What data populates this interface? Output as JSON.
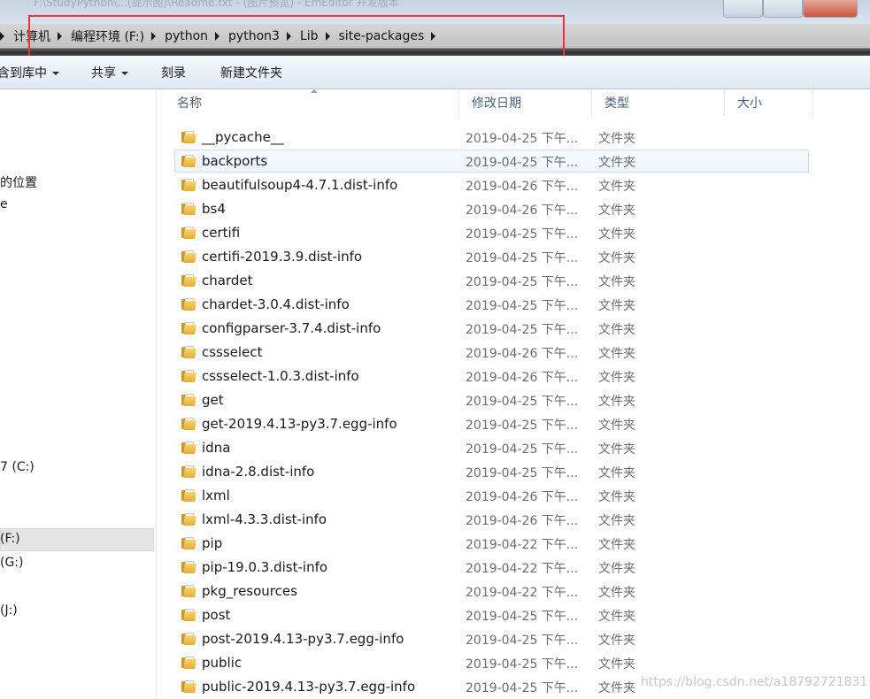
{
  "title_ghost": "F:\\StudyPython\\...(提示图)\\Readme.txt - (图片预览) - EmEditor 开发版本",
  "breadcrumb": [
    "计算机",
    "编程环境 (F:)",
    "python",
    "python3",
    "Lib",
    "site-packages"
  ],
  "toolbar": {
    "include_library": "含到库中",
    "share": "共享",
    "burn": "刻录",
    "new_folder": "新建文件夹"
  },
  "nav": {
    "recent_places": "的位置",
    "item_e": "e",
    "drive_c": "7 (C:)",
    "drive_f": "(F:)",
    "drive_g": "(G:)",
    "drive_j": "(J:)"
  },
  "columns": {
    "name": "名称",
    "modified": "修改日期",
    "type": "类型",
    "size": "大小"
  },
  "files": [
    {
      "name": "__pycache__",
      "date": "2019-04-25 下午...",
      "type": "文件夹"
    },
    {
      "name": "backports",
      "date": "2019-04-25 下午...",
      "type": "文件夹"
    },
    {
      "name": "beautifulsoup4-4.7.1.dist-info",
      "date": "2019-04-26 下午...",
      "type": "文件夹"
    },
    {
      "name": "bs4",
      "date": "2019-04-26 下午...",
      "type": "文件夹"
    },
    {
      "name": "certifi",
      "date": "2019-04-25 下午...",
      "type": "文件夹"
    },
    {
      "name": "certifi-2019.3.9.dist-info",
      "date": "2019-04-25 下午...",
      "type": "文件夹"
    },
    {
      "name": "chardet",
      "date": "2019-04-25 下午...",
      "type": "文件夹"
    },
    {
      "name": "chardet-3.0.4.dist-info",
      "date": "2019-04-25 下午...",
      "type": "文件夹"
    },
    {
      "name": "configparser-3.7.4.dist-info",
      "date": "2019-04-25 下午...",
      "type": "文件夹"
    },
    {
      "name": "cssselect",
      "date": "2019-04-26 下午...",
      "type": "文件夹"
    },
    {
      "name": "cssselect-1.0.3.dist-info",
      "date": "2019-04-26 下午...",
      "type": "文件夹"
    },
    {
      "name": "get",
      "date": "2019-04-25 下午...",
      "type": "文件夹"
    },
    {
      "name": "get-2019.4.13-py3.7.egg-info",
      "date": "2019-04-25 下午...",
      "type": "文件夹"
    },
    {
      "name": "idna",
      "date": "2019-04-25 下午...",
      "type": "文件夹"
    },
    {
      "name": "idna-2.8.dist-info",
      "date": "2019-04-25 下午...",
      "type": "文件夹"
    },
    {
      "name": "lxml",
      "date": "2019-04-26 下午...",
      "type": "文件夹"
    },
    {
      "name": "lxml-4.3.3.dist-info",
      "date": "2019-04-26 下午...",
      "type": "文件夹"
    },
    {
      "name": "pip",
      "date": "2019-04-22 下午...",
      "type": "文件夹"
    },
    {
      "name": "pip-19.0.3.dist-info",
      "date": "2019-04-22 下午...",
      "type": "文件夹"
    },
    {
      "name": "pkg_resources",
      "date": "2019-04-22 下午...",
      "type": "文件夹"
    },
    {
      "name": "post",
      "date": "2019-04-25 下午...",
      "type": "文件夹"
    },
    {
      "name": "post-2019.4.13-py3.7.egg-info",
      "date": "2019-04-25 下午...",
      "type": "文件夹"
    },
    {
      "name": "public",
      "date": "2019-04-25 下午...",
      "type": "文件夹"
    },
    {
      "name": "public-2019.4.13-py3.7.egg-info",
      "date": "2019-04-25 下午...",
      "type": "文件夹"
    }
  ],
  "hover_index": 1,
  "watermark": "https://blog.csdn.net/a18792721831",
  "colors": {
    "highlight_box": "#e8353b",
    "row_hover_border": "#c8dcf0",
    "header_text": "#4c607a"
  }
}
